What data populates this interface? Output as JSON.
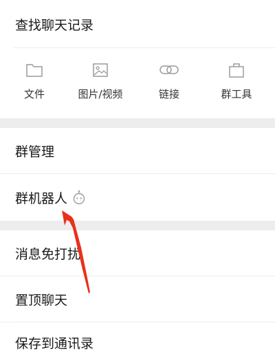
{
  "search_history": {
    "label": "查找聊天记录"
  },
  "tools": [
    {
      "label": "文件",
      "icon": "folder-icon"
    },
    {
      "label": "图片/视频",
      "icon": "image-icon"
    },
    {
      "label": "链接",
      "icon": "link-icon"
    },
    {
      "label": "群工具",
      "icon": "toolbox-icon"
    }
  ],
  "group_settings": {
    "manage": "群管理",
    "robot": "群机器人"
  },
  "chat_settings": {
    "mute": "消息免打扰",
    "pin": "置顶聊天",
    "save": "保存到通讯录"
  },
  "colors": {
    "background": "#ededed",
    "row": "#ffffff",
    "arrow": "#e8301c",
    "icon": "#9a9a9a"
  }
}
